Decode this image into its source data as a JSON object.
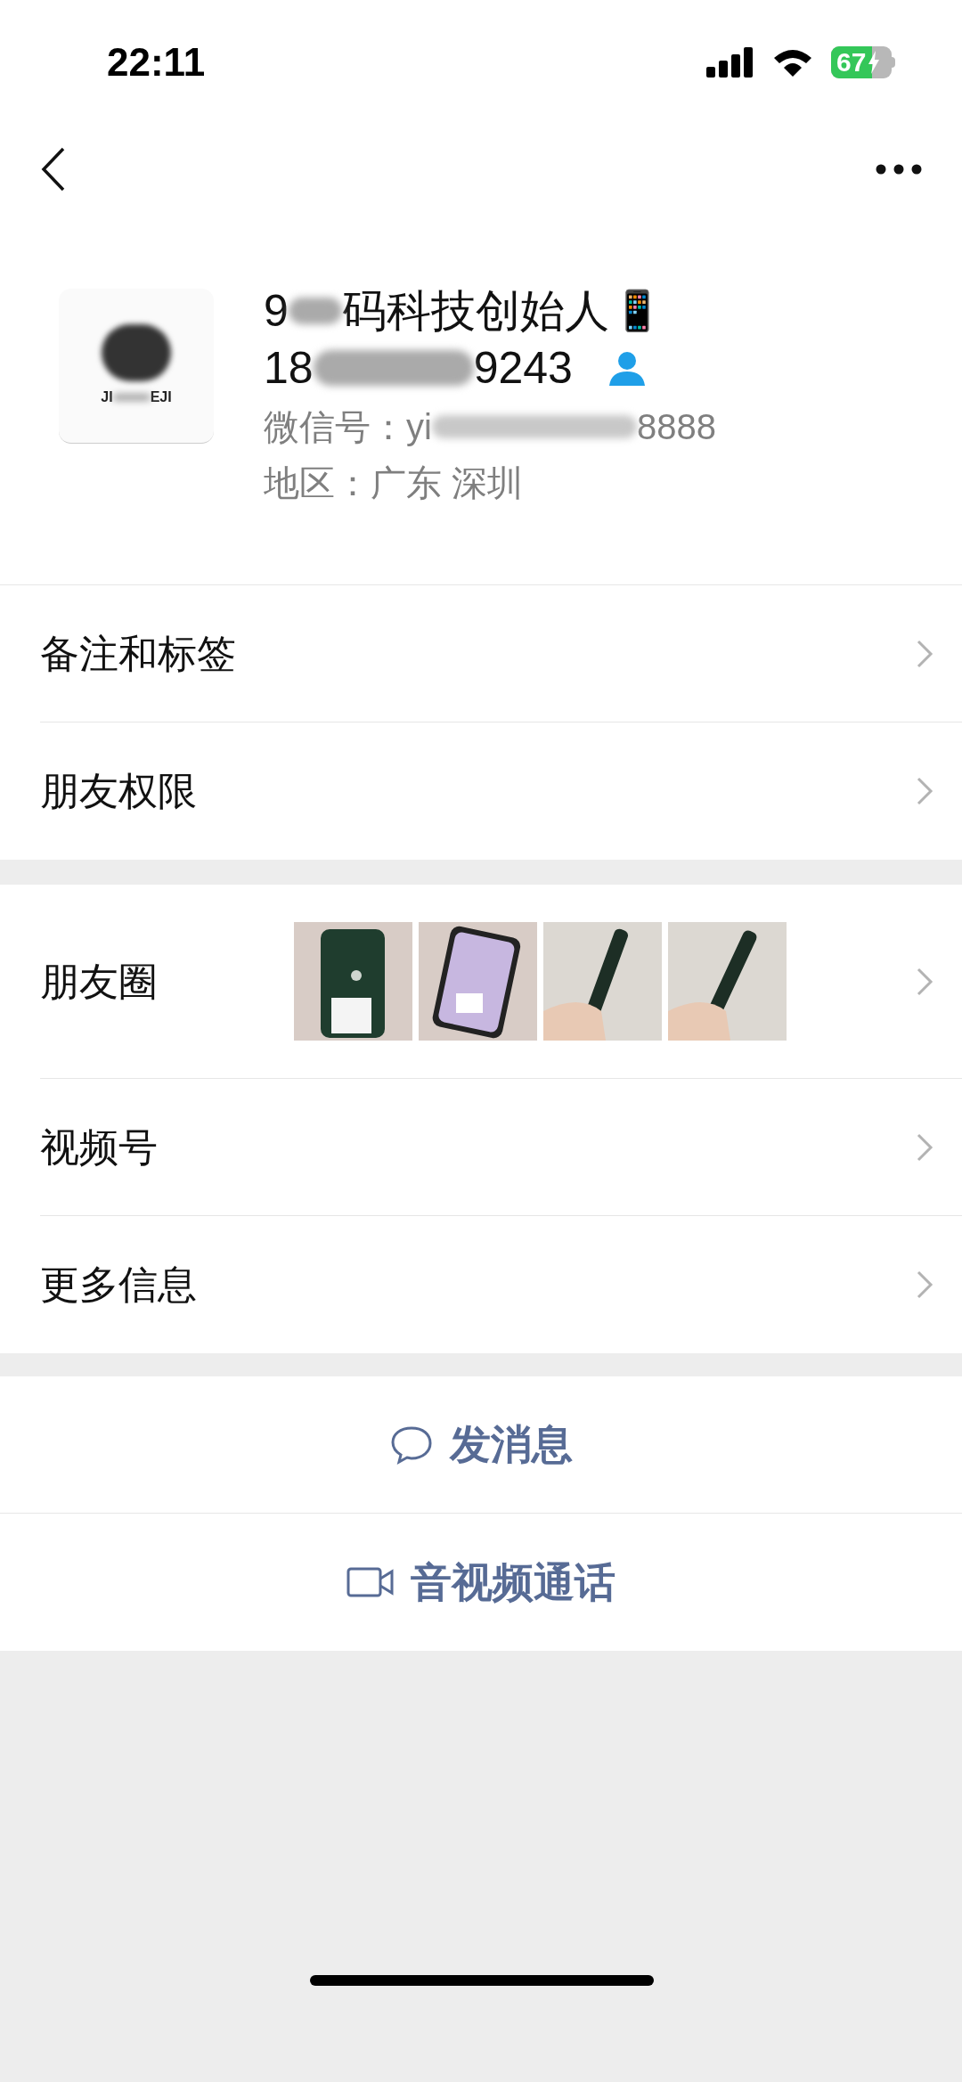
{
  "status_bar": {
    "time": "22:11",
    "battery": "67",
    "charging": true
  },
  "profile": {
    "avatar_text_left": "JI",
    "avatar_text_right": "EJI",
    "name_start": "9",
    "name_end": "码科技创始人",
    "name_emoji": "📱",
    "phone_start": "18",
    "phone_end": "9243",
    "wechat_id_label": "微信号：",
    "wechat_id_start": "yi",
    "wechat_id_end": "8888",
    "region": "地区：广东 深圳"
  },
  "sections": [
    [
      {
        "label": "备注和标签",
        "kind": "plain"
      },
      {
        "label": "朋友权限",
        "kind": "plain"
      }
    ],
    [
      {
        "label": "朋友圈",
        "kind": "photos"
      },
      {
        "label": "视频号",
        "kind": "plain"
      },
      {
        "label": "更多信息",
        "kind": "plain"
      }
    ]
  ],
  "actions": [
    {
      "label": "发消息",
      "kind": "message"
    },
    {
      "label": "音视频通话",
      "kind": "video"
    }
  ]
}
